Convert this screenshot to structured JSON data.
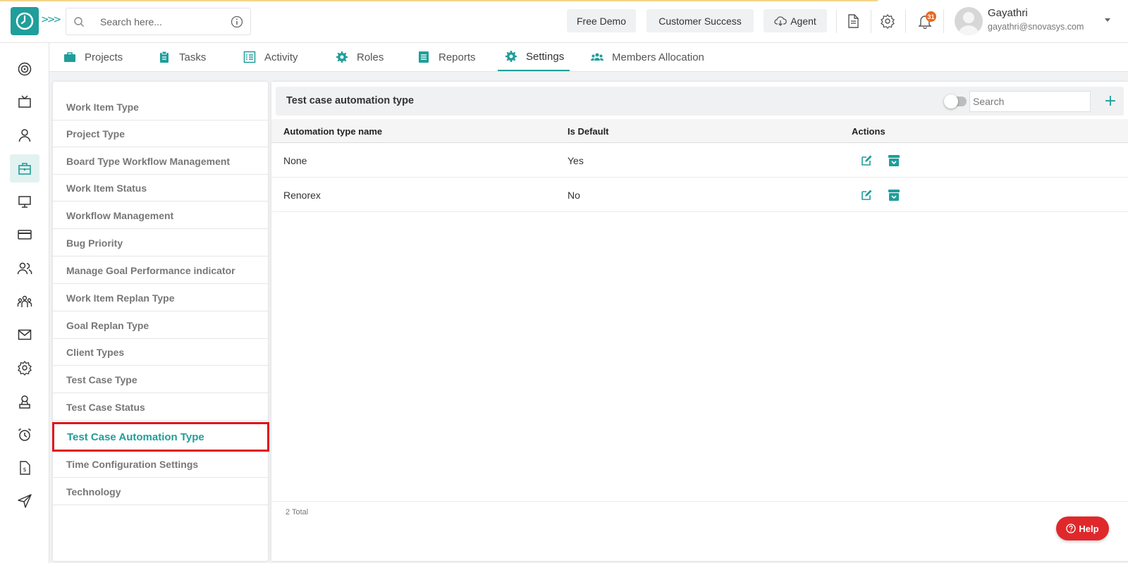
{
  "search": {
    "placeholder": "Search here..."
  },
  "topbar": {
    "free_demo": "Free Demo",
    "customer_success": "Customer Success",
    "agent": "Agent",
    "notification_count": "31"
  },
  "user": {
    "name": "Gayathri",
    "email": "gayathri@snovasys.com"
  },
  "tabs": [
    {
      "label": "Projects",
      "icon": "briefcase-icon"
    },
    {
      "label": "Tasks",
      "icon": "clipboard-icon"
    },
    {
      "label": "Activity",
      "icon": "list-icon"
    },
    {
      "label": "Roles",
      "icon": "gear-icon"
    },
    {
      "label": "Reports",
      "icon": "report-icon"
    },
    {
      "label": "Settings",
      "icon": "gear-icon",
      "active": true
    },
    {
      "label": "Members Allocation",
      "icon": "users-icon"
    }
  ],
  "settings_list": [
    "Work Item Type",
    "Project Type",
    "Board Type Workflow Management",
    "Work Item Status",
    "Workflow Management",
    "Bug Priority",
    "Manage Goal Performance indicator",
    "Work Item Replan Type",
    "Goal Replan Type",
    "Client Types",
    "Test Case Type",
    "Test Case Status",
    "Test Case Automation Type",
    "Time Configuration Settings",
    "Technology"
  ],
  "selected_setting": "Test Case Automation Type",
  "panel": {
    "title": "Test case automation type",
    "search_placeholder": "Search",
    "add_symbol": "+"
  },
  "table": {
    "headers": [
      "Automation type name",
      "Is Default",
      "Actions"
    ],
    "rows": [
      {
        "name": "None",
        "is_default": "Yes"
      },
      {
        "name": "Renorex",
        "is_default": "No"
      }
    ],
    "total": "2 Total"
  },
  "help": {
    "label": "Help"
  },
  "colors": {
    "accent": "#1f9e9b",
    "highlight": "#e0141c",
    "help": "#e0282c",
    "badge": "#e86a1d"
  }
}
